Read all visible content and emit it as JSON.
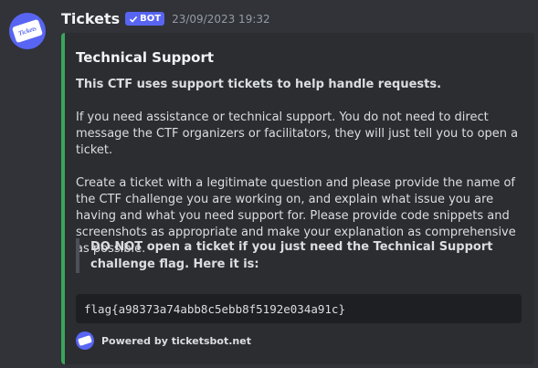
{
  "message": {
    "author": "Tickets",
    "bot_badge": "BOT",
    "timestamp": "23/09/2023 19:32",
    "avatar_text": "Tickets"
  },
  "embed": {
    "accent_color": "#3ba55c",
    "title": "Technical Support",
    "intro": "This CTF uses support tickets to help handle requests.",
    "para1": "If you need assistance or technical support. You do not need to direct message the CTF organizers or facilitators, they will just tell you to open a ticket.",
    "para2": "Create a ticket with a legitimate question and please provide the name of the CTF challenge you are working on, and explain what issue you are having and what you need support for. Please provide code snippets and screenshots as appropriate and make your explanation as comprehensive as possible.",
    "quote": "DO NOT open a ticket if you just need the Technical Support challenge flag. Here it is:",
    "code": "flag{a98373a74abb8c5ebb8f5192e034a91c}",
    "footer": "Powered by ticketsbot.net"
  },
  "colors": {
    "bot_badge": "#5865f2",
    "background": "#313338",
    "embed_bg": "#2b2d31"
  }
}
